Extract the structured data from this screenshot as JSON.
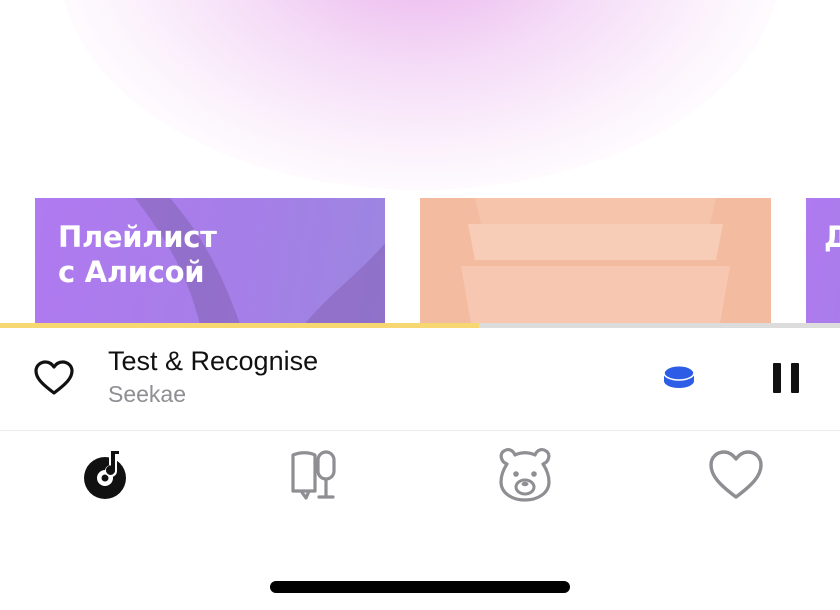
{
  "cards": [
    {
      "title_line1": "Плейлист",
      "title_line2": "с Алисой",
      "color": "#ab7cec"
    },
    {
      "title_line1": "",
      "title_line2": "",
      "color": "#f3bb9f"
    },
    {
      "title_line1": "Д",
      "title_line2": "",
      "color": "#ab7cec"
    }
  ],
  "player": {
    "track_title": "Test & Recognise",
    "artist": "Seekae",
    "progress": 0.57,
    "progress_color": "#f7d772",
    "like_icon": "heart-outline-icon",
    "connect_icon": "device-connect-icon",
    "connect_color": "#2d5de6",
    "pause_icon": "pause-icon"
  },
  "tabs": [
    {
      "id": "music",
      "icon": "music-disc-icon",
      "active": true
    },
    {
      "id": "podcasts",
      "icon": "book-mic-icon",
      "active": false
    },
    {
      "id": "kids",
      "icon": "bear-face-icon",
      "active": false
    },
    {
      "id": "collection",
      "icon": "heart-outline-icon",
      "active": false
    }
  ]
}
